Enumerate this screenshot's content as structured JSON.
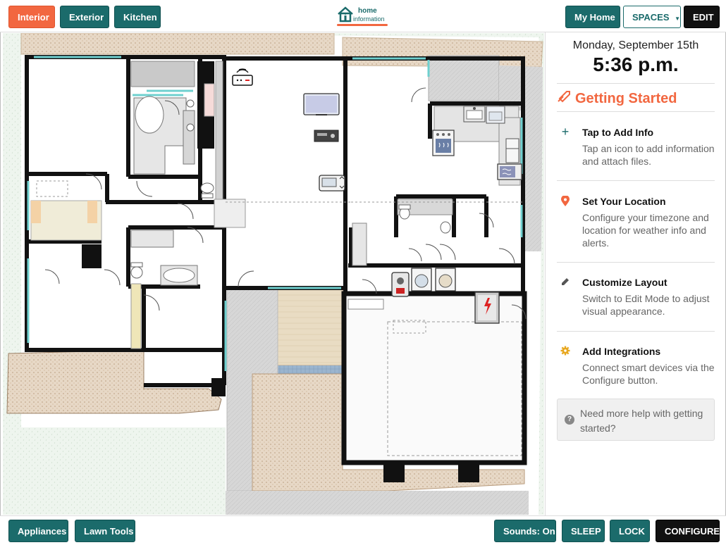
{
  "top_nav": {
    "interior": "Interior",
    "exterior": "Exterior",
    "kitchen": "Kitchen",
    "my_home": "My Home",
    "spaces": "SPACES",
    "edit": "EDIT"
  },
  "logo": {
    "line1": "home",
    "line2": "information"
  },
  "sidebar": {
    "date": "Monday, September 15th",
    "time": "5:36 p.m.",
    "heading": "Getting Started",
    "items": [
      {
        "title": "Tap to Add Info",
        "desc": "Tap an icon to add information and attach files.",
        "icon": "plus-icon"
      },
      {
        "title": "Set Your Location",
        "desc": "Configure your timezone and location for weather info and alerts.",
        "icon": "location-pin-icon"
      },
      {
        "title": "Customize Layout",
        "desc": "Switch to Edit Mode to adjust visual appearance.",
        "icon": "pencil-icon"
      },
      {
        "title": "Add Integrations",
        "desc": "Connect smart devices via the Configure button.",
        "icon": "gear-icon"
      }
    ],
    "help": "Need more help with getting started?"
  },
  "bottom_nav": {
    "appliances": "Appliances",
    "lawn_tools": "Lawn Tools",
    "sounds": "Sounds: On",
    "sleep": "SLEEP",
    "lock": "LOCK",
    "configure": "CONFIGURE"
  },
  "colors": {
    "accent": "#1b6b6b",
    "brand": "#f26740",
    "dark": "#111111"
  }
}
